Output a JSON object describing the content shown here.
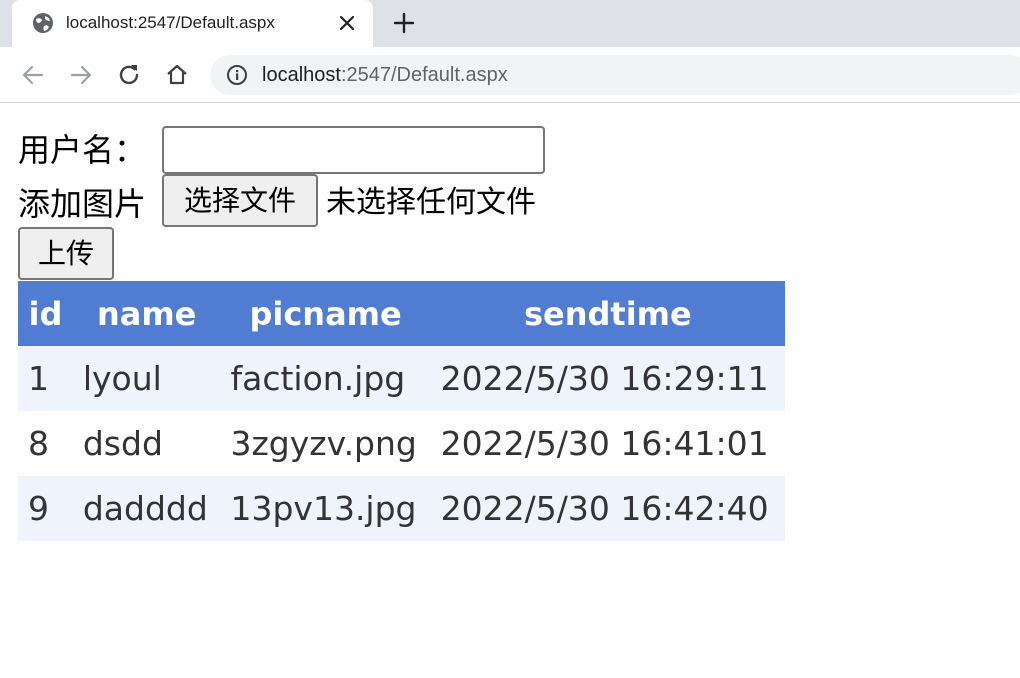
{
  "browser": {
    "tab_title": "localhost:2547/Default.aspx",
    "url_host": "localhost",
    "url_rest": ":2547/Default.aspx"
  },
  "form": {
    "username_label": "用户名：",
    "username_value": "",
    "add_image_label": "添加图片",
    "choose_file_label": "选择文件",
    "file_status": "未选择任何文件",
    "upload_label": "上传"
  },
  "grid": {
    "columns": [
      "id",
      "name",
      "picname",
      "sendtime"
    ],
    "rows": [
      [
        "1",
        "lyoul",
        "faction.jpg",
        "2022/5/30 16:29:11"
      ],
      [
        "8",
        "dsdd",
        "3zgyzv.png",
        "2022/5/30 16:41:01"
      ],
      [
        "9",
        "dadddd",
        "13pv13.jpg",
        "2022/5/30 16:42:40"
      ]
    ],
    "header_color": "#507cd1",
    "alt_row_color": "#eff3fb"
  }
}
